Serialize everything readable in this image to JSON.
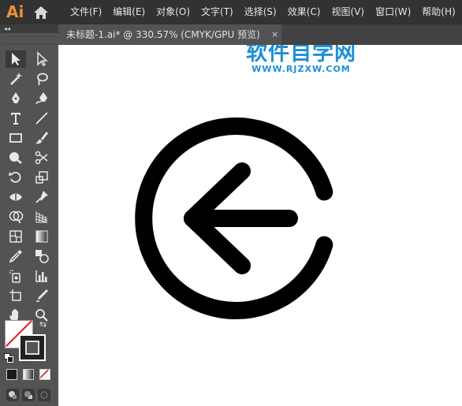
{
  "app": {
    "logo_text": "Ai"
  },
  "menu": {
    "items": [
      "文件(F)",
      "编辑(E)",
      "对象(O)",
      "文字(T)",
      "选择(S)",
      "效果(C)",
      "视图(V)",
      "窗口(W)",
      "帮助(H)"
    ]
  },
  "toolbar": {
    "collapse_glyph": "◂◂"
  },
  "document": {
    "tab_label": "未标题-1.ai* @ 330.57% (CMYK/GPU 预览)",
    "close_glyph": "×"
  },
  "watermark": {
    "title": "软件自学网",
    "url": "WWW.RJZXW.COM"
  },
  "colors": {
    "menubar": "#323232",
    "panel": "#535353",
    "accent_logo": "#e8923a",
    "watermark": "#1e8fd6",
    "canvas": "#ffffff",
    "artwork": "#000000"
  },
  "icons": [
    "home-icon",
    "selection-tool-icon",
    "direct-selection-tool-icon",
    "magic-wand-icon",
    "lasso-icon",
    "pen-tool-icon",
    "curvature-tool-icon",
    "type-tool-icon",
    "line-tool-icon",
    "rectangle-tool-icon",
    "paintbrush-icon",
    "shaper-tool-icon",
    "scissors-icon",
    "rotate-tool-icon",
    "scale-tool-icon",
    "width-tool-icon",
    "puppet-warp-icon",
    "shape-builder-icon",
    "perspective-grid-icon",
    "mesh-tool-icon",
    "gradient-tool-icon",
    "eyedropper-icon",
    "blend-tool-icon",
    "symbol-sprayer-icon",
    "column-graph-icon",
    "artboard-tool-icon",
    "slice-tool-icon",
    "hand-tool-icon",
    "zoom-tool-icon"
  ]
}
